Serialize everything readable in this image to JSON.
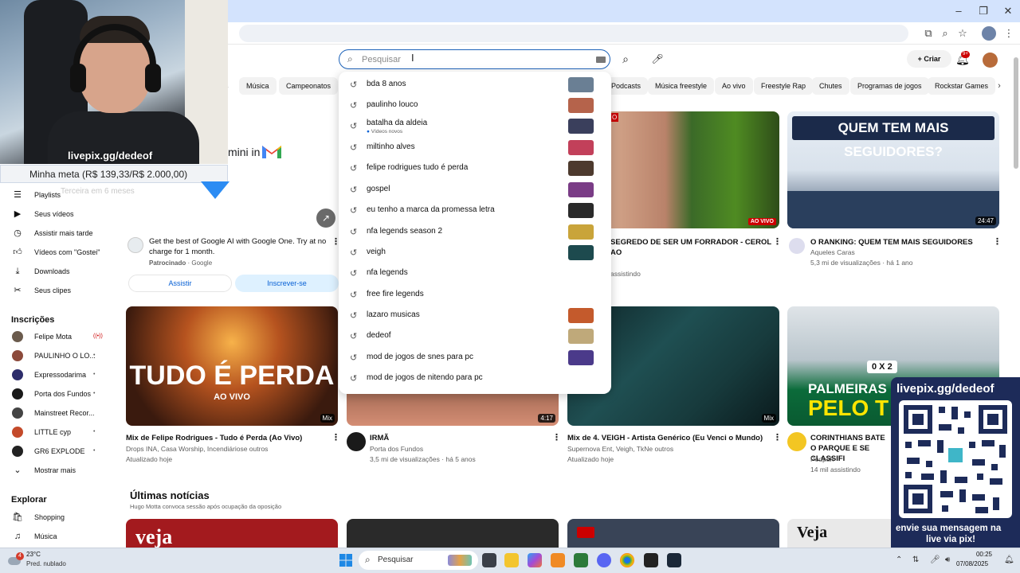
{
  "webcam": {
    "watermark": "livepix.gg/dedeof",
    "meta_text": "Minha meta (R$ 139,33/R$ 2.000,00)",
    "meta_sub": "Terceira em 6 meses"
  },
  "header": {
    "search_placeholder": "Pesquisar",
    "create_label": "Criar",
    "notifications_badge": "9+"
  },
  "chips": [
    "s",
    "Música",
    "Campeonatos",
    "Podcasts",
    "Música freestyle",
    "Ao vivo",
    "Freestyle Rap",
    "Chutes",
    "Programas de jogos",
    "Rockstar Games"
  ],
  "suggestions": [
    {
      "text": "bda 8 anos",
      "has_thumb": true,
      "thumb_color": "#6a7f94"
    },
    {
      "text": "paulinho louco",
      "has_thumb": true,
      "thumb_color": "#b5634b"
    },
    {
      "text": "batalha da aldeia",
      "note": "Vídeos novos",
      "has_thumb": true,
      "thumb_color": "#3a3f5c"
    },
    {
      "text": "miltinho alves",
      "has_thumb": true,
      "thumb_color": "#c2405a"
    },
    {
      "text": "felipe rodrigues tudo é perda",
      "has_thumb": true,
      "thumb_color": "#4d3a2e"
    },
    {
      "text": "gospel",
      "has_thumb": true,
      "thumb_color": "#7a3c86"
    },
    {
      "text": "eu tenho a marca da promessa letra",
      "has_thumb": true,
      "thumb_color": "#2a2a2a"
    },
    {
      "text": "nfa legends season 2",
      "has_thumb": true,
      "thumb_color": "#c9a43a"
    },
    {
      "text": "veigh",
      "has_thumb": true,
      "thumb_color": "#1d4a4e"
    },
    {
      "text": "nfa legends",
      "has_thumb": false
    },
    {
      "text": "free fire legends",
      "has_thumb": false
    },
    {
      "text": "lazaro musicas",
      "has_thumb": true,
      "thumb_color": "#c45a2c"
    },
    {
      "text": "dedeof",
      "has_thumb": true,
      "thumb_color": "#bfa97a"
    },
    {
      "text": "mod de jogos de snes para pc",
      "has_thumb": true,
      "thumb_color": "#4b3a8a"
    },
    {
      "text": "mod de jogos de nitendo para pc",
      "has_thumb": false
    }
  ],
  "sidebar": {
    "items": [
      {
        "label": "Playlists",
        "icon": "playlist-icon"
      },
      {
        "label": "Seus vídeos",
        "icon": "video-icon"
      },
      {
        "label": "Assistir mais tarde",
        "icon": "clock-icon"
      },
      {
        "label": "Vídeos com \"Gostei\"",
        "icon": "thumb-up-icon"
      },
      {
        "label": "Downloads",
        "icon": "download-icon"
      },
      {
        "label": "Seus clipes",
        "icon": "scissors-icon"
      }
    ],
    "subs_heading": "Inscrições",
    "subs": [
      {
        "label": "Felipe Mota",
        "color": "#6b5b4d",
        "live": true
      },
      {
        "label": "PAULINHO O LO...",
        "color": "#8c4a3b",
        "live": false
      },
      {
        "label": "Expressodarima",
        "color": "#2d2d6b",
        "live": false
      },
      {
        "label": "Porta dos Fundos",
        "color": "#1a1a1a",
        "live": false
      },
      {
        "label": "Mainstreet Recor...",
        "color": "#444444",
        "live": false
      },
      {
        "label": "LITTLE cyp",
        "color": "#c44a2a",
        "live": false
      },
      {
        "label": "GR6 EXPLODE",
        "color": "#222222",
        "live": false
      }
    ],
    "more_label": "Mostrar mais",
    "explore_heading": "Explorar",
    "explore": [
      {
        "label": "Shopping",
        "icon": "shopping-icon"
      },
      {
        "label": "Música",
        "icon": "music-icon"
      }
    ]
  },
  "ad": {
    "gemini_text": "mini in",
    "text": "Get the best of Google AI with Google One. Try at no charge for 1 month.",
    "sponsored": "Patrocinado",
    "advertiser": "Google",
    "watch_label": "Assistir",
    "subscribe_label": "Inscrever-se"
  },
  "top_videos": [
    {
      "title": "SEGREDO DE SER UM FORRADOR - CEROL AO",
      "meta2": "assistindo",
      "badge": "AO VIVO"
    },
    {
      "title": "O RANKING: QUEM TEM MAIS SEGUIDORES",
      "channel": "Aqueles Caras",
      "meta2": "5,3 mi de visualizações · há 1 ano",
      "duration": "24:47",
      "thumb_caption": "QUEM TEM MAIS SEGUIDORES?"
    }
  ],
  "videos": [
    {
      "title": "Mix de Felipe Rodrigues - Tudo é Perda (Ao Vivo)",
      "meta1": "Drops INA, Casa Worship, Incendiáriose outros",
      "meta2": "Atualizado hoje",
      "badge": "Mix",
      "thumb_caption": "TUDO É PERDA",
      "thumb_sub": "AO VIVO"
    },
    {
      "title": "IRMÃ",
      "meta1": "Porta dos Fundos",
      "meta2": "3,5 mi de visualizações · há 5 anos",
      "duration": "4:17"
    },
    {
      "title": "Mix de 4. VEIGH - Artista Genérico (Eu Venci o Mundo)",
      "meta1": "Supernova Ent, Veigh, TkNe outros",
      "meta2": "Atualizado hoje",
      "badge": "Mix"
    },
    {
      "title": "CORINTHIANS BATE O PARQUE E SE CLASSIFI",
      "meta1": "Podpah",
      "meta2": "14 mil assistindo",
      "thumb_caption": "PALMEIRAS",
      "thumb_sub": "PELO T",
      "score": "0 X 2"
    }
  ],
  "news": {
    "heading": "Últimas notícias",
    "sub": "Hugo Motta convoca sessão após ocupação da oposição",
    "thumb1_caption": "veja",
    "thumb4_caption": "Veja"
  },
  "qr": {
    "title": "livepix.gg/dedeof",
    "footer_line1": "envie sua mensagem na",
    "footer_line2": "live via pix!"
  },
  "taskbar": {
    "temperature": "23°C",
    "condition": "Pred. nublado",
    "weather_badge": "4",
    "search_label": "Pesquisar",
    "time": "00:25",
    "date": "07/08/2025"
  },
  "colors": {
    "accent": "#065fd4",
    "live_red": "#cc0000",
    "qr_bg": "#1d2b59",
    "meta_arrow": "#2c8cf3"
  }
}
